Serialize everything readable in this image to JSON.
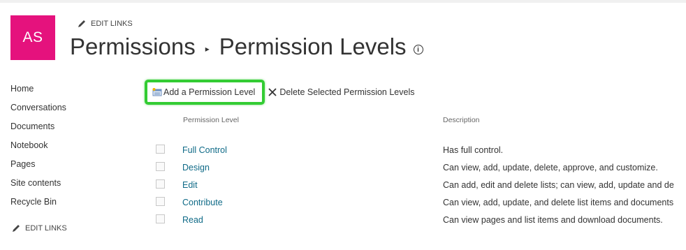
{
  "site": {
    "logo_initials": "AS",
    "edit_links_label": "EDIT LINKS"
  },
  "header": {
    "breadcrumb_parent": "Permissions",
    "breadcrumb_separator": "▸",
    "page_title": "Permission Levels",
    "info_glyph": "i"
  },
  "quicklaunch": {
    "items": [
      {
        "label": "Home"
      },
      {
        "label": "Conversations"
      },
      {
        "label": "Documents"
      },
      {
        "label": "Notebook"
      },
      {
        "label": "Pages"
      },
      {
        "label": "Site contents"
      },
      {
        "label": "Recycle Bin"
      }
    ],
    "edit_links_label": "EDIT LINKS"
  },
  "toolbar": {
    "add_label": "Add a Permission Level",
    "delete_label": "Delete Selected Permission Levels",
    "highlight_color": "#33cc33"
  },
  "table": {
    "columns": [
      "Permission Level",
      "Description"
    ],
    "rows": [
      {
        "name": "Full Control",
        "description": "Has full control."
      },
      {
        "name": "Design",
        "description": "Can view, add, update, delete, approve, and customize."
      },
      {
        "name": "Edit",
        "description": "Can add, edit and delete lists; can view, add, update and de"
      },
      {
        "name": "Contribute",
        "description": "Can view, add, update, and delete list items and documents"
      },
      {
        "name": "Read",
        "description": "Can view pages and list items and download documents."
      }
    ]
  },
  "colors": {
    "logo_bg": "#e5127d",
    "link": "#0f6a87"
  },
  "icons": {
    "pencil": "pencil-icon",
    "info": "info-icon",
    "add": "add-permission-icon",
    "delete": "close-icon"
  }
}
